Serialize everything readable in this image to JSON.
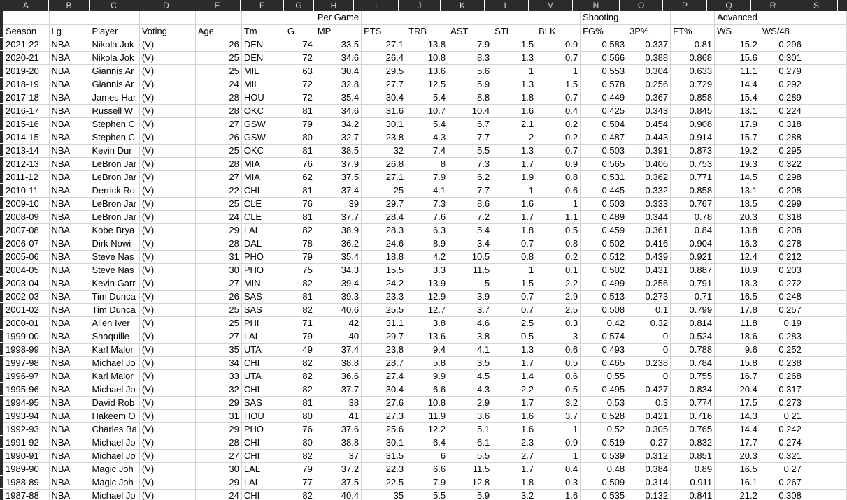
{
  "app": {
    "type": "spreadsheet",
    "column_letters": [
      "A",
      "B",
      "C",
      "D",
      "E",
      "F",
      "G",
      "H",
      "I",
      "J",
      "K",
      "L",
      "M",
      "N",
      "O",
      "P",
      "Q",
      "R",
      "S"
    ],
    "header_bar_color": "#2b2b2b",
    "header_text_color": "#d8d8d8",
    "gridline_color": "#d4d4d4",
    "cell_background": "#ffffff"
  },
  "group_header_row": {
    "H": "Per Game",
    "N": "Shooting",
    "Q": "Advanced"
  },
  "column_headers": [
    "Season",
    "Lg",
    "Player",
    "Voting",
    "Age",
    "Tm",
    "G",
    "MP",
    "PTS",
    "TRB",
    "AST",
    "STL",
    "BLK",
    "FG%",
    "3P%",
    "FT%",
    "WS",
    "WS/48"
  ],
  "rows": [
    {
      "Season": "2021-22",
      "Lg": "NBA",
      "Player": "Nikola Jok",
      "Voting": "(V)",
      "Age": "26",
      "Tm": "DEN",
      "G": "74",
      "MP": "33.5",
      "PTS": "27.1",
      "TRB": "13.8",
      "AST": "7.9",
      "STL": "1.5",
      "BLK": "0.9",
      "FG": "0.583",
      "P3": "0.337",
      "FT": "0.81",
      "WS": "15.2",
      "WS48": "0.296"
    },
    {
      "Season": "2020-21",
      "Lg": "NBA",
      "Player": "Nikola Jok",
      "Voting": "(V)",
      "Age": "25",
      "Tm": "DEN",
      "G": "72",
      "MP": "34.6",
      "PTS": "26.4",
      "TRB": "10.8",
      "AST": "8.3",
      "STL": "1.3",
      "BLK": "0.7",
      "FG": "0.566",
      "P3": "0.388",
      "FT": "0.868",
      "WS": "15.6",
      "WS48": "0.301"
    },
    {
      "Season": "2019-20",
      "Lg": "NBA",
      "Player": "Giannis Ar",
      "Voting": "(V)",
      "Age": "25",
      "Tm": "MIL",
      "G": "63",
      "MP": "30.4",
      "PTS": "29.5",
      "TRB": "13.6",
      "AST": "5.6",
      "STL": "1",
      "BLK": "1",
      "FG": "0.553",
      "P3": "0.304",
      "FT": "0.633",
      "WS": "11.1",
      "WS48": "0.279"
    },
    {
      "Season": "2018-19",
      "Lg": "NBA",
      "Player": "Giannis Ar",
      "Voting": "(V)",
      "Age": "24",
      "Tm": "MIL",
      "G": "72",
      "MP": "32.8",
      "PTS": "27.7",
      "TRB": "12.5",
      "AST": "5.9",
      "STL": "1.3",
      "BLK": "1.5",
      "FG": "0.578",
      "P3": "0.256",
      "FT": "0.729",
      "WS": "14.4",
      "WS48": "0.292"
    },
    {
      "Season": "2017-18",
      "Lg": "NBA",
      "Player": "James Har",
      "Voting": "(V)",
      "Age": "28",
      "Tm": "HOU",
      "G": "72",
      "MP": "35.4",
      "PTS": "30.4",
      "TRB": "5.4",
      "AST": "8.8",
      "STL": "1.8",
      "BLK": "0.7",
      "FG": "0.449",
      "P3": "0.367",
      "FT": "0.858",
      "WS": "15.4",
      "WS48": "0.289"
    },
    {
      "Season": "2016-17",
      "Lg": "NBA",
      "Player": "Russell W",
      "Voting": "(V)",
      "Age": "28",
      "Tm": "OKC",
      "G": "81",
      "MP": "34.6",
      "PTS": "31.6",
      "TRB": "10.7",
      "AST": "10.4",
      "STL": "1.6",
      "BLK": "0.4",
      "FG": "0.425",
      "P3": "0.343",
      "FT": "0.845",
      "WS": "13.1",
      "WS48": "0.224"
    },
    {
      "Season": "2015-16",
      "Lg": "NBA",
      "Player": "Stephen C",
      "Voting": "(V)",
      "Age": "27",
      "Tm": "GSW",
      "G": "79",
      "MP": "34.2",
      "PTS": "30.1",
      "TRB": "5.4",
      "AST": "6.7",
      "STL": "2.1",
      "BLK": "0.2",
      "FG": "0.504",
      "P3": "0.454",
      "FT": "0.908",
      "WS": "17.9",
      "WS48": "0.318"
    },
    {
      "Season": "2014-15",
      "Lg": "NBA",
      "Player": "Stephen C",
      "Voting": "(V)",
      "Age": "26",
      "Tm": "GSW",
      "G": "80",
      "MP": "32.7",
      "PTS": "23.8",
      "TRB": "4.3",
      "AST": "7.7",
      "STL": "2",
      "BLK": "0.2",
      "FG": "0.487",
      "P3": "0.443",
      "FT": "0.914",
      "WS": "15.7",
      "WS48": "0.288"
    },
    {
      "Season": "2013-14",
      "Lg": "NBA",
      "Player": "Kevin Dur",
      "Voting": "(V)",
      "Age": "25",
      "Tm": "OKC",
      "G": "81",
      "MP": "38.5",
      "PTS": "32",
      "TRB": "7.4",
      "AST": "5.5",
      "STL": "1.3",
      "BLK": "0.7",
      "FG": "0.503",
      "P3": "0.391",
      "FT": "0.873",
      "WS": "19.2",
      "WS48": "0.295"
    },
    {
      "Season": "2012-13",
      "Lg": "NBA",
      "Player": "LeBron Jar",
      "Voting": "(V)",
      "Age": "28",
      "Tm": "MIA",
      "G": "76",
      "MP": "37.9",
      "PTS": "26.8",
      "TRB": "8",
      "AST": "7.3",
      "STL": "1.7",
      "BLK": "0.9",
      "FG": "0.565",
      "P3": "0.406",
      "FT": "0.753",
      "WS": "19.3",
      "WS48": "0.322"
    },
    {
      "Season": "2011-12",
      "Lg": "NBA",
      "Player": "LeBron Jar",
      "Voting": "(V)",
      "Age": "27",
      "Tm": "MIA",
      "G": "62",
      "MP": "37.5",
      "PTS": "27.1",
      "TRB": "7.9",
      "AST": "6.2",
      "STL": "1.9",
      "BLK": "0.8",
      "FG": "0.531",
      "P3": "0.362",
      "FT": "0.771",
      "WS": "14.5",
      "WS48": "0.298"
    },
    {
      "Season": "2010-11",
      "Lg": "NBA",
      "Player": "Derrick Ro",
      "Voting": "(V)",
      "Age": "22",
      "Tm": "CHI",
      "G": "81",
      "MP": "37.4",
      "PTS": "25",
      "TRB": "4.1",
      "AST": "7.7",
      "STL": "1",
      "BLK": "0.6",
      "FG": "0.445",
      "P3": "0.332",
      "FT": "0.858",
      "WS": "13.1",
      "WS48": "0.208"
    },
    {
      "Season": "2009-10",
      "Lg": "NBA",
      "Player": "LeBron Jar",
      "Voting": "(V)",
      "Age": "25",
      "Tm": "CLE",
      "G": "76",
      "MP": "39",
      "PTS": "29.7",
      "TRB": "7.3",
      "AST": "8.6",
      "STL": "1.6",
      "BLK": "1",
      "FG": "0.503",
      "P3": "0.333",
      "FT": "0.767",
      "WS": "18.5",
      "WS48": "0.299"
    },
    {
      "Season": "2008-09",
      "Lg": "NBA",
      "Player": "LeBron Jar",
      "Voting": "(V)",
      "Age": "24",
      "Tm": "CLE",
      "G": "81",
      "MP": "37.7",
      "PTS": "28.4",
      "TRB": "7.6",
      "AST": "7.2",
      "STL": "1.7",
      "BLK": "1.1",
      "FG": "0.489",
      "P3": "0.344",
      "FT": "0.78",
      "WS": "20.3",
      "WS48": "0.318"
    },
    {
      "Season": "2007-08",
      "Lg": "NBA",
      "Player": "Kobe Brya",
      "Voting": "(V)",
      "Age": "29",
      "Tm": "LAL",
      "G": "82",
      "MP": "38.9",
      "PTS": "28.3",
      "TRB": "6.3",
      "AST": "5.4",
      "STL": "1.8",
      "BLK": "0.5",
      "FG": "0.459",
      "P3": "0.361",
      "FT": "0.84",
      "WS": "13.8",
      "WS48": "0.208"
    },
    {
      "Season": "2006-07",
      "Lg": "NBA",
      "Player": "Dirk Nowi",
      "Voting": "(V)",
      "Age": "28",
      "Tm": "DAL",
      "G": "78",
      "MP": "36.2",
      "PTS": "24.6",
      "TRB": "8.9",
      "AST": "3.4",
      "STL": "0.7",
      "BLK": "0.8",
      "FG": "0.502",
      "P3": "0.416",
      "FT": "0.904",
      "WS": "16.3",
      "WS48": "0.278"
    },
    {
      "Season": "2005-06",
      "Lg": "NBA",
      "Player": "Steve Nas",
      "Voting": "(V)",
      "Age": "31",
      "Tm": "PHO",
      "G": "79",
      "MP": "35.4",
      "PTS": "18.8",
      "TRB": "4.2",
      "AST": "10.5",
      "STL": "0.8",
      "BLK": "0.2",
      "FG": "0.512",
      "P3": "0.439",
      "FT": "0.921",
      "WS": "12.4",
      "WS48": "0.212"
    },
    {
      "Season": "2004-05",
      "Lg": "NBA",
      "Player": "Steve Nas",
      "Voting": "(V)",
      "Age": "30",
      "Tm": "PHO",
      "G": "75",
      "MP": "34.3",
      "PTS": "15.5",
      "TRB": "3.3",
      "AST": "11.5",
      "STL": "1",
      "BLK": "0.1",
      "FG": "0.502",
      "P3": "0.431",
      "FT": "0.887",
      "WS": "10.9",
      "WS48": "0.203"
    },
    {
      "Season": "2003-04",
      "Lg": "NBA",
      "Player": "Kevin Garr",
      "Voting": "(V)",
      "Age": "27",
      "Tm": "MIN",
      "G": "82",
      "MP": "39.4",
      "PTS": "24.2",
      "TRB": "13.9",
      "AST": "5",
      "STL": "1.5",
      "BLK": "2.2",
      "FG": "0.499",
      "P3": "0.256",
      "FT": "0.791",
      "WS": "18.3",
      "WS48": "0.272"
    },
    {
      "Season": "2002-03",
      "Lg": "NBA",
      "Player": "Tim Dunca",
      "Voting": "(V)",
      "Age": "26",
      "Tm": "SAS",
      "G": "81",
      "MP": "39.3",
      "PTS": "23.3",
      "TRB": "12.9",
      "AST": "3.9",
      "STL": "0.7",
      "BLK": "2.9",
      "FG": "0.513",
      "P3": "0.273",
      "FT": "0.71",
      "WS": "16.5",
      "WS48": "0.248"
    },
    {
      "Season": "2001-02",
      "Lg": "NBA",
      "Player": "Tim Dunca",
      "Voting": "(V)",
      "Age": "25",
      "Tm": "SAS",
      "G": "82",
      "MP": "40.6",
      "PTS": "25.5",
      "TRB": "12.7",
      "AST": "3.7",
      "STL": "0.7",
      "BLK": "2.5",
      "FG": "0.508",
      "P3": "0.1",
      "FT": "0.799",
      "WS": "17.8",
      "WS48": "0.257"
    },
    {
      "Season": "2000-01",
      "Lg": "NBA",
      "Player": "Allen Iver",
      "Voting": "(V)",
      "Age": "25",
      "Tm": "PHI",
      "G": "71",
      "MP": "42",
      "PTS": "31.1",
      "TRB": "3.8",
      "AST": "4.6",
      "STL": "2.5",
      "BLK": "0.3",
      "FG": "0.42",
      "P3": "0.32",
      "FT": "0.814",
      "WS": "11.8",
      "WS48": "0.19"
    },
    {
      "Season": "1999-00",
      "Lg": "NBA",
      "Player": "Shaquille",
      "Voting": "(V)",
      "Age": "27",
      "Tm": "LAL",
      "G": "79",
      "MP": "40",
      "PTS": "29.7",
      "TRB": "13.6",
      "AST": "3.8",
      "STL": "0.5",
      "BLK": "3",
      "FG": "0.574",
      "P3": "0",
      "FT": "0.524",
      "WS": "18.6",
      "WS48": "0.283"
    },
    {
      "Season": "1998-99",
      "Lg": "NBA",
      "Player": "Karl Malor",
      "Voting": "(V)",
      "Age": "35",
      "Tm": "UTA",
      "G": "49",
      "MP": "37.4",
      "PTS": "23.8",
      "TRB": "9.4",
      "AST": "4.1",
      "STL": "1.3",
      "BLK": "0.6",
      "FG": "0.493",
      "P3": "0",
      "FT": "0.788",
      "WS": "9.6",
      "WS48": "0.252"
    },
    {
      "Season": "1997-98",
      "Lg": "NBA",
      "Player": "Michael Jo",
      "Voting": "(V)",
      "Age": "34",
      "Tm": "CHI",
      "G": "82",
      "MP": "38.8",
      "PTS": "28.7",
      "TRB": "5.8",
      "AST": "3.5",
      "STL": "1.7",
      "BLK": "0.5",
      "FG": "0.465",
      "P3": "0.238",
      "FT": "0.784",
      "WS": "15.8",
      "WS48": "0.238"
    },
    {
      "Season": "1996-97",
      "Lg": "NBA",
      "Player": "Karl Malor",
      "Voting": "(V)",
      "Age": "33",
      "Tm": "UTA",
      "G": "82",
      "MP": "36.6",
      "PTS": "27.4",
      "TRB": "9.9",
      "AST": "4.5",
      "STL": "1.4",
      "BLK": "0.6",
      "FG": "0.55",
      "P3": "0",
      "FT": "0.755",
      "WS": "16.7",
      "WS48": "0.268"
    },
    {
      "Season": "1995-96",
      "Lg": "NBA",
      "Player": "Michael Jo",
      "Voting": "(V)",
      "Age": "32",
      "Tm": "CHI",
      "G": "82",
      "MP": "37.7",
      "PTS": "30.4",
      "TRB": "6.6",
      "AST": "4.3",
      "STL": "2.2",
      "BLK": "0.5",
      "FG": "0.495",
      "P3": "0.427",
      "FT": "0.834",
      "WS": "20.4",
      "WS48": "0.317"
    },
    {
      "Season": "1994-95",
      "Lg": "NBA",
      "Player": "David Rob",
      "Voting": "(V)",
      "Age": "29",
      "Tm": "SAS",
      "G": "81",
      "MP": "38",
      "PTS": "27.6",
      "TRB": "10.8",
      "AST": "2.9",
      "STL": "1.7",
      "BLK": "3.2",
      "FG": "0.53",
      "P3": "0.3",
      "FT": "0.774",
      "WS": "17.5",
      "WS48": "0.273"
    },
    {
      "Season": "1993-94",
      "Lg": "NBA",
      "Player": "Hakeem O",
      "Voting": "(V)",
      "Age": "31",
      "Tm": "HOU",
      "G": "80",
      "MP": "41",
      "PTS": "27.3",
      "TRB": "11.9",
      "AST": "3.6",
      "STL": "1.6",
      "BLK": "3.7",
      "FG": "0.528",
      "P3": "0.421",
      "FT": "0.716",
      "WS": "14.3",
      "WS48": "0.21"
    },
    {
      "Season": "1992-93",
      "Lg": "NBA",
      "Player": "Charles Ba",
      "Voting": "(V)",
      "Age": "29",
      "Tm": "PHO",
      "G": "76",
      "MP": "37.6",
      "PTS": "25.6",
      "TRB": "12.2",
      "AST": "5.1",
      "STL": "1.6",
      "BLK": "1",
      "FG": "0.52",
      "P3": "0.305",
      "FT": "0.765",
      "WS": "14.4",
      "WS48": "0.242"
    },
    {
      "Season": "1991-92",
      "Lg": "NBA",
      "Player": "Michael Jo",
      "Voting": "(V)",
      "Age": "28",
      "Tm": "CHI",
      "G": "80",
      "MP": "38.8",
      "PTS": "30.1",
      "TRB": "6.4",
      "AST": "6.1",
      "STL": "2.3",
      "BLK": "0.9",
      "FG": "0.519",
      "P3": "0.27",
      "FT": "0.832",
      "WS": "17.7",
      "WS48": "0.274"
    },
    {
      "Season": "1990-91",
      "Lg": "NBA",
      "Player": "Michael Jo",
      "Voting": "(V)",
      "Age": "27",
      "Tm": "CHI",
      "G": "82",
      "MP": "37",
      "PTS": "31.5",
      "TRB": "6",
      "AST": "5.5",
      "STL": "2.7",
      "BLK": "1",
      "FG": "0.539",
      "P3": "0.312",
      "FT": "0.851",
      "WS": "20.3",
      "WS48": "0.321"
    },
    {
      "Season": "1989-90",
      "Lg": "NBA",
      "Player": "Magic Joh",
      "Voting": "(V)",
      "Age": "30",
      "Tm": "LAL",
      "G": "79",
      "MP": "37.2",
      "PTS": "22.3",
      "TRB": "6.6",
      "AST": "11.5",
      "STL": "1.7",
      "BLK": "0.4",
      "FG": "0.48",
      "P3": "0.384",
      "FT": "0.89",
      "WS": "16.5",
      "WS48": "0.27"
    },
    {
      "Season": "1988-89",
      "Lg": "NBA",
      "Player": "Magic Joh",
      "Voting": "(V)",
      "Age": "29",
      "Tm": "LAL",
      "G": "77",
      "MP": "37.5",
      "PTS": "22.5",
      "TRB": "7.9",
      "AST": "12.8",
      "STL": "1.8",
      "BLK": "0.3",
      "FG": "0.509",
      "P3": "0.314",
      "FT": "0.911",
      "WS": "16.1",
      "WS48": "0.267"
    },
    {
      "Season": "1987-88",
      "Lg": "NBA",
      "Player": "Michael Jo",
      "Voting": "(V)",
      "Age": "24",
      "Tm": "CHI",
      "G": "82",
      "MP": "40.4",
      "PTS": "35",
      "TRB": "5.5",
      "AST": "5.9",
      "STL": "3.2",
      "BLK": "1.6",
      "FG": "0.535",
      "P3": "0.132",
      "FT": "0.841",
      "WS": "21.2",
      "WS48": "0.308"
    }
  ]
}
